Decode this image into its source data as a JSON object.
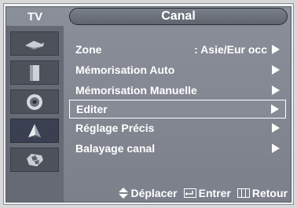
{
  "header": {
    "tv_label": "TV",
    "title": "Canal"
  },
  "sidebar": {
    "items": [
      {
        "icon": "antenna-icon"
      },
      {
        "icon": "picture-icon"
      },
      {
        "icon": "speaker-icon"
      },
      {
        "icon": "channel-icon"
      },
      {
        "icon": "setup-icon"
      }
    ]
  },
  "menu": {
    "items": [
      {
        "label": "Zone",
        "value": ": Asie/Eur occ"
      },
      {
        "label": "Mémorisation Auto"
      },
      {
        "label": "Mémorisation Manuelle"
      },
      {
        "label": "Editer"
      },
      {
        "label": "Réglage Précis"
      },
      {
        "label": "Balayage canal"
      }
    ],
    "highlighted_index": 3
  },
  "help": {
    "move_label": "Déplacer",
    "enter_label": "Entrer",
    "return_label": "Retour"
  }
}
